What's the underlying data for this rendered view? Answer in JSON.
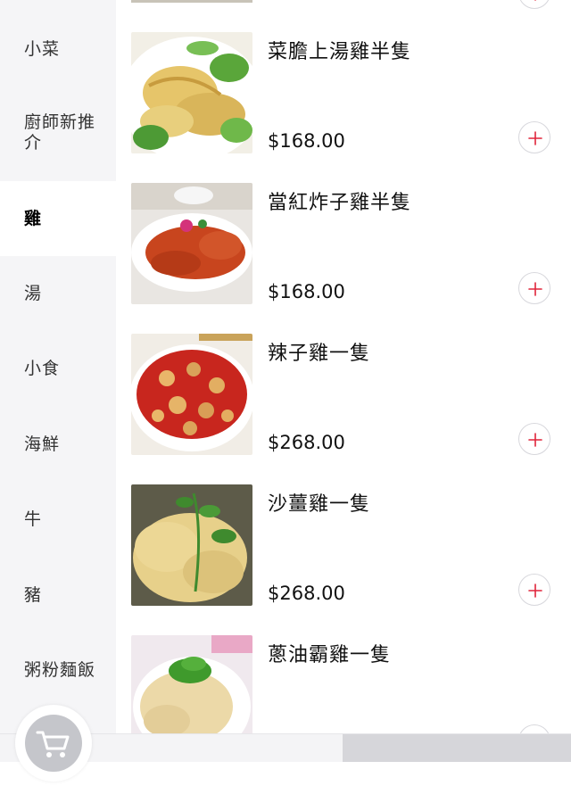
{
  "sidebar": {
    "items": [
      {
        "label": "小菜"
      },
      {
        "label": "廚師新推介"
      },
      {
        "label": "雞"
      },
      {
        "label": "湯"
      },
      {
        "label": "小食"
      },
      {
        "label": "海鮮"
      },
      {
        "label": "牛"
      },
      {
        "label": "豬"
      },
      {
        "label": "粥粉麵飯"
      }
    ],
    "active_label": "雞"
  },
  "menu_items": [
    {
      "name": "菜膽上湯雞半隻",
      "price": "$168.00"
    },
    {
      "name": "當紅炸子雞半隻",
      "price": "$168.00"
    },
    {
      "name": "辣子雞一隻",
      "price": "$268.00"
    },
    {
      "name": "沙薑雞一隻",
      "price": "$268.00"
    },
    {
      "name": "蔥油霸雞一隻",
      "price": ""
    }
  ],
  "icons": {
    "add": "plus-circle-icon",
    "cart": "shopping-cart-icon"
  },
  "colors": {
    "accent": "#e0243a",
    "sidebar_bg": "#f5f5f7",
    "active_bg": "#ffffff"
  }
}
